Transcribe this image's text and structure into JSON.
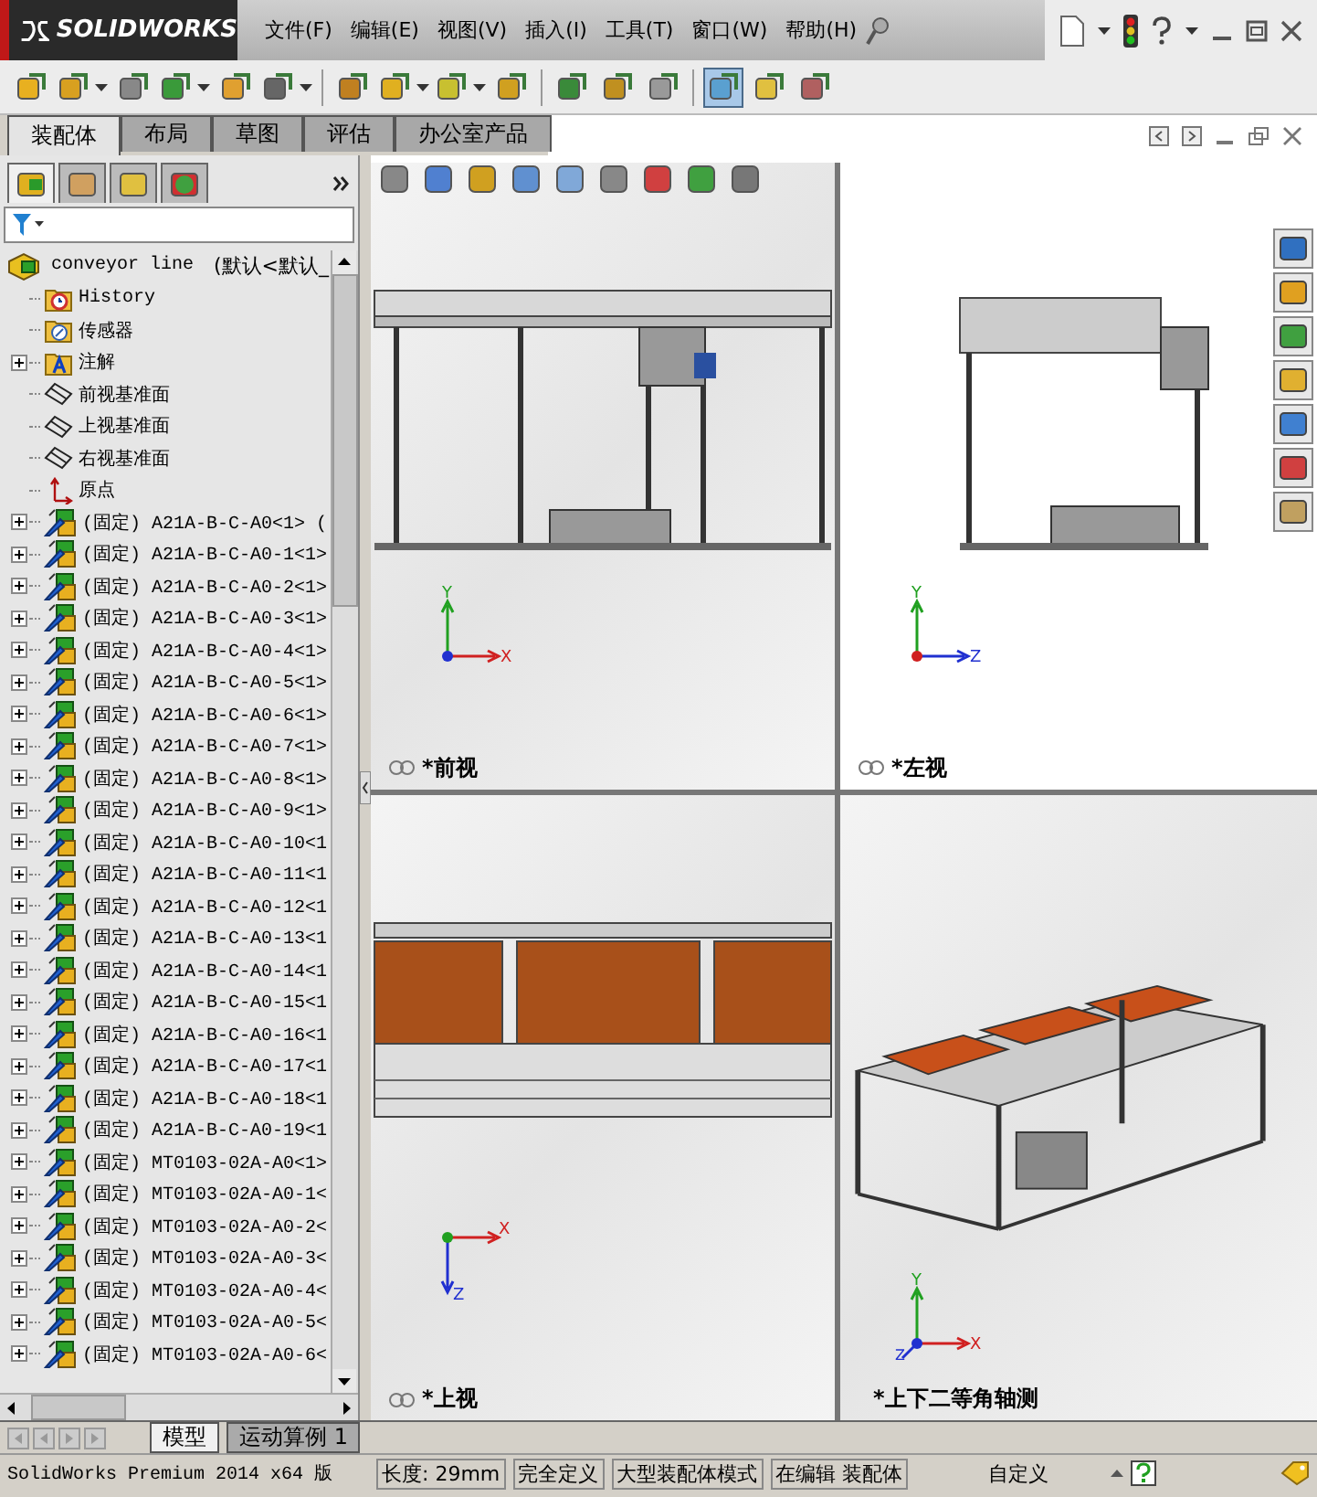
{
  "app": {
    "logo": "SOLIDWORKS"
  },
  "menu": [
    "文件(F)",
    "编辑(E)",
    "视图(V)",
    "插入(I)",
    "工具(T)",
    "窗口(W)",
    "帮助(H)"
  ],
  "toolbar": [
    {
      "dropdown": false,
      "selected": false
    },
    {
      "dropdown": true,
      "selected": false
    },
    {
      "dropdown": false,
      "selected": false
    },
    {
      "dropdown": true,
      "selected": false
    },
    {
      "dropdown": false,
      "selected": false
    },
    {
      "dropdown": true,
      "selected": false
    },
    {
      "dropdown": false,
      "selected": false
    },
    {
      "dropdown": true,
      "selected": false
    },
    {
      "dropdown": true,
      "selected": false
    },
    {
      "dropdown": false,
      "selected": false
    },
    {
      "dropdown": false,
      "selected": false
    },
    {
      "dropdown": false,
      "selected": false
    },
    {
      "dropdown": false,
      "selected": false
    },
    {
      "dropdown": false,
      "selected": true
    },
    {
      "dropdown": false,
      "selected": false
    },
    {
      "dropdown": false,
      "selected": false
    }
  ],
  "command_tabs": [
    {
      "label": "装配体",
      "selected": true
    },
    {
      "label": "布局",
      "selected": false
    },
    {
      "label": "草图",
      "selected": false
    },
    {
      "label": "评估",
      "selected": false
    },
    {
      "label": "办公室产品",
      "selected": false
    }
  ],
  "panel_tabs": [
    {
      "selected": true
    },
    {
      "selected": false
    },
    {
      "selected": false
    },
    {
      "selected": false
    }
  ],
  "tree": {
    "root": {
      "label": "conveyor line",
      "config": "(默认<默认_"
    },
    "items": [
      {
        "kind": "history",
        "label": "History",
        "expandable": false
      },
      {
        "kind": "sensor",
        "label": "传感器",
        "expandable": false
      },
      {
        "kind": "annotation",
        "label": "注解",
        "expandable": true
      },
      {
        "kind": "plane",
        "label": "前视基准面",
        "expandable": false
      },
      {
        "kind": "plane",
        "label": "上视基准面",
        "expandable": false
      },
      {
        "kind": "plane",
        "label": "右视基准面",
        "expandable": false
      },
      {
        "kind": "origin",
        "label": "原点",
        "expandable": false
      },
      {
        "kind": "part",
        "label": "(固定) A21A-B-C-A0<1> (",
        "expandable": true
      },
      {
        "kind": "part",
        "label": "(固定) A21A-B-C-A0-1<1>",
        "expandable": true
      },
      {
        "kind": "part",
        "label": "(固定) A21A-B-C-A0-2<1>",
        "expandable": true
      },
      {
        "kind": "part",
        "label": "(固定) A21A-B-C-A0-3<1>",
        "expandable": true
      },
      {
        "kind": "part",
        "label": "(固定) A21A-B-C-A0-4<1>",
        "expandable": true
      },
      {
        "kind": "part",
        "label": "(固定) A21A-B-C-A0-5<1>",
        "expandable": true
      },
      {
        "kind": "part",
        "label": "(固定) A21A-B-C-A0-6<1>",
        "expandable": true
      },
      {
        "kind": "part",
        "label": "(固定) A21A-B-C-A0-7<1>",
        "expandable": true
      },
      {
        "kind": "part",
        "label": "(固定) A21A-B-C-A0-8<1>",
        "expandable": true
      },
      {
        "kind": "part",
        "label": "(固定) A21A-B-C-A0-9<1>",
        "expandable": true
      },
      {
        "kind": "part",
        "label": "(固定) A21A-B-C-A0-10<1",
        "expandable": true
      },
      {
        "kind": "part",
        "label": "(固定) A21A-B-C-A0-11<1",
        "expandable": true
      },
      {
        "kind": "part",
        "label": "(固定) A21A-B-C-A0-12<1",
        "expandable": true
      },
      {
        "kind": "part",
        "label": "(固定) A21A-B-C-A0-13<1",
        "expandable": true
      },
      {
        "kind": "part",
        "label": "(固定) A21A-B-C-A0-14<1",
        "expandable": true
      },
      {
        "kind": "part",
        "label": "(固定) A21A-B-C-A0-15<1",
        "expandable": true
      },
      {
        "kind": "part",
        "label": "(固定) A21A-B-C-A0-16<1",
        "expandable": true
      },
      {
        "kind": "part",
        "label": "(固定) A21A-B-C-A0-17<1",
        "expandable": true
      },
      {
        "kind": "part",
        "label": "(固定) A21A-B-C-A0-18<1",
        "expandable": true
      },
      {
        "kind": "part",
        "label": "(固定) A21A-B-C-A0-19<1",
        "expandable": true
      },
      {
        "kind": "part",
        "label": "(固定) MT0103-02A-A0<1>",
        "expandable": true
      },
      {
        "kind": "part",
        "label": "(固定) MT0103-02A-A0-1<",
        "expandable": true
      },
      {
        "kind": "part",
        "label": "(固定) MT0103-02A-A0-2<",
        "expandable": true
      },
      {
        "kind": "part",
        "label": "(固定) MT0103-02A-A0-3<",
        "expandable": true
      },
      {
        "kind": "part",
        "label": "(固定) MT0103-02A-A0-4<",
        "expandable": true
      },
      {
        "kind": "part",
        "label": "(固定) MT0103-02A-A0-5<",
        "expandable": true
      },
      {
        "kind": "part",
        "label": "(固定) MT0103-02A-A0-6<",
        "expandable": true
      }
    ]
  },
  "viewports": [
    {
      "kind": "front",
      "label": "*前视",
      "linked": true,
      "triad": [
        "Y",
        "X"
      ]
    },
    {
      "kind": "left",
      "label": "*左视",
      "linked": true,
      "triad": [
        "Y",
        "Z"
      ]
    },
    {
      "kind": "top",
      "label": "*上视",
      "linked": true,
      "triad": [
        "X",
        "Z"
      ]
    },
    {
      "kind": "iso",
      "label": "*上下二等角轴测",
      "linked": false,
      "triad": [
        "Y",
        "X",
        "Z"
      ]
    }
  ],
  "bottom_tabs": [
    {
      "label": "模型",
      "selected": true
    },
    {
      "label": "运动算例 1",
      "selected": false
    }
  ],
  "status_bar": {
    "product": "SolidWorks Premium 2014 x64 版",
    "fields": [
      "长度: 29mm",
      "完全定义",
      "大型装配体模式",
      "在编辑 装配体"
    ],
    "units": "自定义"
  }
}
